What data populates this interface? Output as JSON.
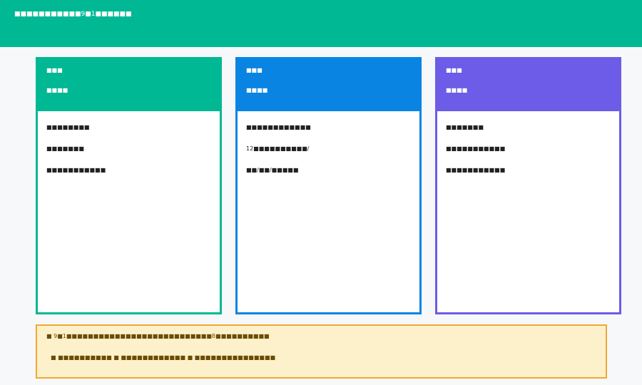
{
  "header": {
    "title": "■■■■■■■■■■■9■1■■■■■■"
  },
  "cards": [
    {
      "label": "■■■",
      "sub": "■■■■",
      "lines": [
        "■■■■■■■■",
        "■■■■■■■",
        "■■■■■■■■■■■"
      ],
      "color": "#00b894"
    },
    {
      "label": "■■■",
      "sub": "■■■■",
      "lines": [
        "■■■■■■■■■■■■",
        "12■■■■■■■■■■/",
        "■■/■■/■■■■■"
      ],
      "color": "#0984e3"
    },
    {
      "label": "■■■",
      "sub": "■■■■",
      "lines": [
        "■■■■■■■",
        "■■■■■■■■■■■",
        "■■■■■■■■■■■"
      ],
      "color": "#6c5ce7"
    }
  ],
  "notice": {
    "line1": "■ 9■1■■■■■■■■■■■■■■■■■■■■■■■■■■■8■■■■■■■■■■",
    "line2": "■ ■■■■■■■■■■  ■ ■■■■■■■■■■■■  ■ ■■■■■■■■■■■■■■■"
  }
}
